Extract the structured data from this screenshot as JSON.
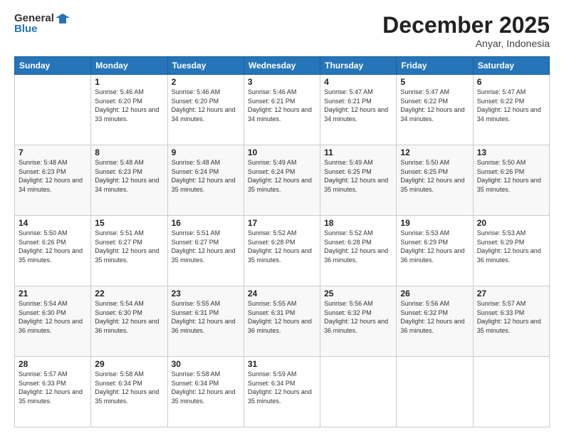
{
  "header": {
    "logo_line1": "General",
    "logo_line2": "Blue",
    "month": "December 2025",
    "location": "Anyar, Indonesia"
  },
  "weekdays": [
    "Sunday",
    "Monday",
    "Tuesday",
    "Wednesday",
    "Thursday",
    "Friday",
    "Saturday"
  ],
  "weeks": [
    [
      {
        "day": "",
        "sunrise": "",
        "sunset": "",
        "daylight": ""
      },
      {
        "day": "1",
        "sunrise": "5:46 AM",
        "sunset": "6:20 PM",
        "daylight": "12 hours and 33 minutes."
      },
      {
        "day": "2",
        "sunrise": "5:46 AM",
        "sunset": "6:20 PM",
        "daylight": "12 hours and 34 minutes."
      },
      {
        "day": "3",
        "sunrise": "5:46 AM",
        "sunset": "6:21 PM",
        "daylight": "12 hours and 34 minutes."
      },
      {
        "day": "4",
        "sunrise": "5:47 AM",
        "sunset": "6:21 PM",
        "daylight": "12 hours and 34 minutes."
      },
      {
        "day": "5",
        "sunrise": "5:47 AM",
        "sunset": "6:22 PM",
        "daylight": "12 hours and 34 minutes."
      },
      {
        "day": "6",
        "sunrise": "5:47 AM",
        "sunset": "6:22 PM",
        "daylight": "12 hours and 34 minutes."
      }
    ],
    [
      {
        "day": "7",
        "sunrise": "5:48 AM",
        "sunset": "6:23 PM",
        "daylight": "12 hours and 34 minutes."
      },
      {
        "day": "8",
        "sunrise": "5:48 AM",
        "sunset": "6:23 PM",
        "daylight": "12 hours and 34 minutes."
      },
      {
        "day": "9",
        "sunrise": "5:48 AM",
        "sunset": "6:24 PM",
        "daylight": "12 hours and 35 minutes."
      },
      {
        "day": "10",
        "sunrise": "5:49 AM",
        "sunset": "6:24 PM",
        "daylight": "12 hours and 35 minutes."
      },
      {
        "day": "11",
        "sunrise": "5:49 AM",
        "sunset": "6:25 PM",
        "daylight": "12 hours and 35 minutes."
      },
      {
        "day": "12",
        "sunrise": "5:50 AM",
        "sunset": "6:25 PM",
        "daylight": "12 hours and 35 minutes."
      },
      {
        "day": "13",
        "sunrise": "5:50 AM",
        "sunset": "6:26 PM",
        "daylight": "12 hours and 35 minutes."
      }
    ],
    [
      {
        "day": "14",
        "sunrise": "5:50 AM",
        "sunset": "6:26 PM",
        "daylight": "12 hours and 35 minutes."
      },
      {
        "day": "15",
        "sunrise": "5:51 AM",
        "sunset": "6:27 PM",
        "daylight": "12 hours and 35 minutes."
      },
      {
        "day": "16",
        "sunrise": "5:51 AM",
        "sunset": "6:27 PM",
        "daylight": "12 hours and 35 minutes."
      },
      {
        "day": "17",
        "sunrise": "5:52 AM",
        "sunset": "6:28 PM",
        "daylight": "12 hours and 35 minutes."
      },
      {
        "day": "18",
        "sunrise": "5:52 AM",
        "sunset": "6:28 PM",
        "daylight": "12 hours and 36 minutes."
      },
      {
        "day": "19",
        "sunrise": "5:53 AM",
        "sunset": "6:29 PM",
        "daylight": "12 hours and 36 minutes."
      },
      {
        "day": "20",
        "sunrise": "5:53 AM",
        "sunset": "6:29 PM",
        "daylight": "12 hours and 36 minutes."
      }
    ],
    [
      {
        "day": "21",
        "sunrise": "5:54 AM",
        "sunset": "6:30 PM",
        "daylight": "12 hours and 36 minutes."
      },
      {
        "day": "22",
        "sunrise": "5:54 AM",
        "sunset": "6:30 PM",
        "daylight": "12 hours and 36 minutes."
      },
      {
        "day": "23",
        "sunrise": "5:55 AM",
        "sunset": "6:31 PM",
        "daylight": "12 hours and 36 minutes."
      },
      {
        "day": "24",
        "sunrise": "5:55 AM",
        "sunset": "6:31 PM",
        "daylight": "12 hours and 36 minutes."
      },
      {
        "day": "25",
        "sunrise": "5:56 AM",
        "sunset": "6:32 PM",
        "daylight": "12 hours and 36 minutes."
      },
      {
        "day": "26",
        "sunrise": "5:56 AM",
        "sunset": "6:32 PM",
        "daylight": "12 hours and 36 minutes."
      },
      {
        "day": "27",
        "sunrise": "5:57 AM",
        "sunset": "6:33 PM",
        "daylight": "12 hours and 35 minutes."
      }
    ],
    [
      {
        "day": "28",
        "sunrise": "5:57 AM",
        "sunset": "6:33 PM",
        "daylight": "12 hours and 35 minutes."
      },
      {
        "day": "29",
        "sunrise": "5:58 AM",
        "sunset": "6:34 PM",
        "daylight": "12 hours and 35 minutes."
      },
      {
        "day": "30",
        "sunrise": "5:58 AM",
        "sunset": "6:34 PM",
        "daylight": "12 hours and 35 minutes."
      },
      {
        "day": "31",
        "sunrise": "5:59 AM",
        "sunset": "6:34 PM",
        "daylight": "12 hours and 35 minutes."
      },
      {
        "day": "",
        "sunrise": "",
        "sunset": "",
        "daylight": ""
      },
      {
        "day": "",
        "sunrise": "",
        "sunset": "",
        "daylight": ""
      },
      {
        "day": "",
        "sunrise": "",
        "sunset": "",
        "daylight": ""
      }
    ]
  ],
  "labels": {
    "sunrise": "Sunrise:",
    "sunset": "Sunset:",
    "daylight": "Daylight:"
  }
}
